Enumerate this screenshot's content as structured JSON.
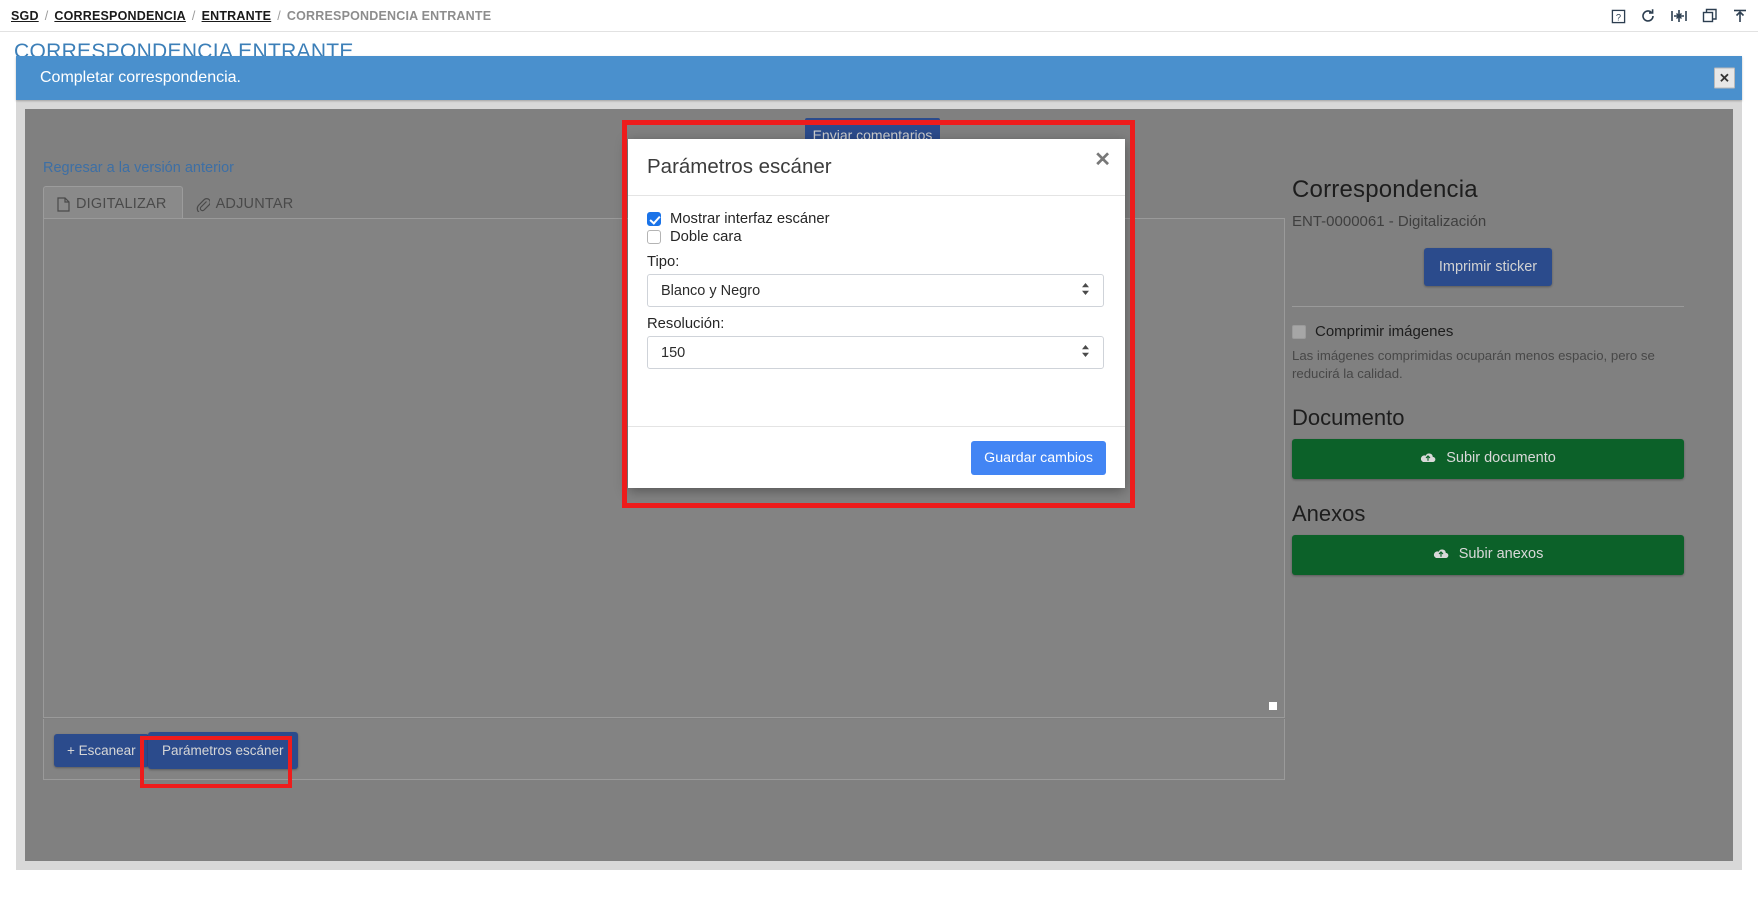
{
  "breadcrumb": {
    "items": [
      {
        "label": "SGD",
        "link": true
      },
      {
        "label": "CORRESPONDENCIA",
        "link": true
      },
      {
        "label": "ENTRANTE",
        "link": true
      },
      {
        "label": "CORRESPONDENCIA ENTRANTE",
        "link": false
      }
    ],
    "separator": "/"
  },
  "topbar_icons": [
    {
      "name": "help-icon",
      "glyph": "?"
    },
    {
      "name": "refresh-icon",
      "glyph": "↻"
    },
    {
      "name": "collapse-horizontal-icon",
      "glyph": "↔"
    },
    {
      "name": "restore-window-icon",
      "glyph": "❐"
    },
    {
      "name": "pin-top-icon",
      "glyph": "⤒"
    }
  ],
  "page": {
    "title": "CORRESPONDENCIA ENTRANTE"
  },
  "alert": {
    "message": "Completar correspondencia.",
    "close_label": "✕",
    "bg_color": "#4a90cd"
  },
  "main": {
    "back_link": "Regresar a la versión anterior",
    "tabs": [
      {
        "label": "DIGITALIZAR",
        "icon": "file-icon",
        "active": true
      },
      {
        "label": "ADJUNTAR",
        "icon": "paperclip-icon",
        "active": false
      }
    ],
    "feedback_button": "Enviar comentarios",
    "scan_button": "+ Escanear",
    "scan_params_button": "Parámetros escáner"
  },
  "sidebar": {
    "title": "Correspondencia",
    "subtitle": "ENT-0000061 - Digitalización",
    "print_sticker_button": "Imprimir sticker",
    "compress": {
      "label": "Comprimir imágenes",
      "checked": false,
      "help": "Las imágenes comprimidas ocuparán menos espacio, pero se reducirá la calidad."
    },
    "document_section": {
      "title": "Documento",
      "button": "Subir documento",
      "button_icon": "cloud-upload-icon",
      "color": "#0c6129"
    },
    "annex_section": {
      "title": "Anexos",
      "button": "Subir anexos",
      "button_icon": "cloud-upload-icon",
      "color": "#0c6129"
    }
  },
  "modal": {
    "title": "Parámetros escáner",
    "close_label": "✕",
    "show_interface": {
      "label": "Mostrar interfaz escáner",
      "checked": true
    },
    "double_side": {
      "label": "Doble cara",
      "checked": false
    },
    "type": {
      "label": "Tipo:",
      "value": "Blanco y Negro"
    },
    "resolution": {
      "label": "Resolución:",
      "value": "150"
    },
    "save_button": "Guardar cambios",
    "save_button_color": "#4285f4"
  },
  "annotations": {
    "highlight_color": "#ee1c1c",
    "boxes": [
      "modal-highlight",
      "scan-params-button-highlight"
    ]
  }
}
